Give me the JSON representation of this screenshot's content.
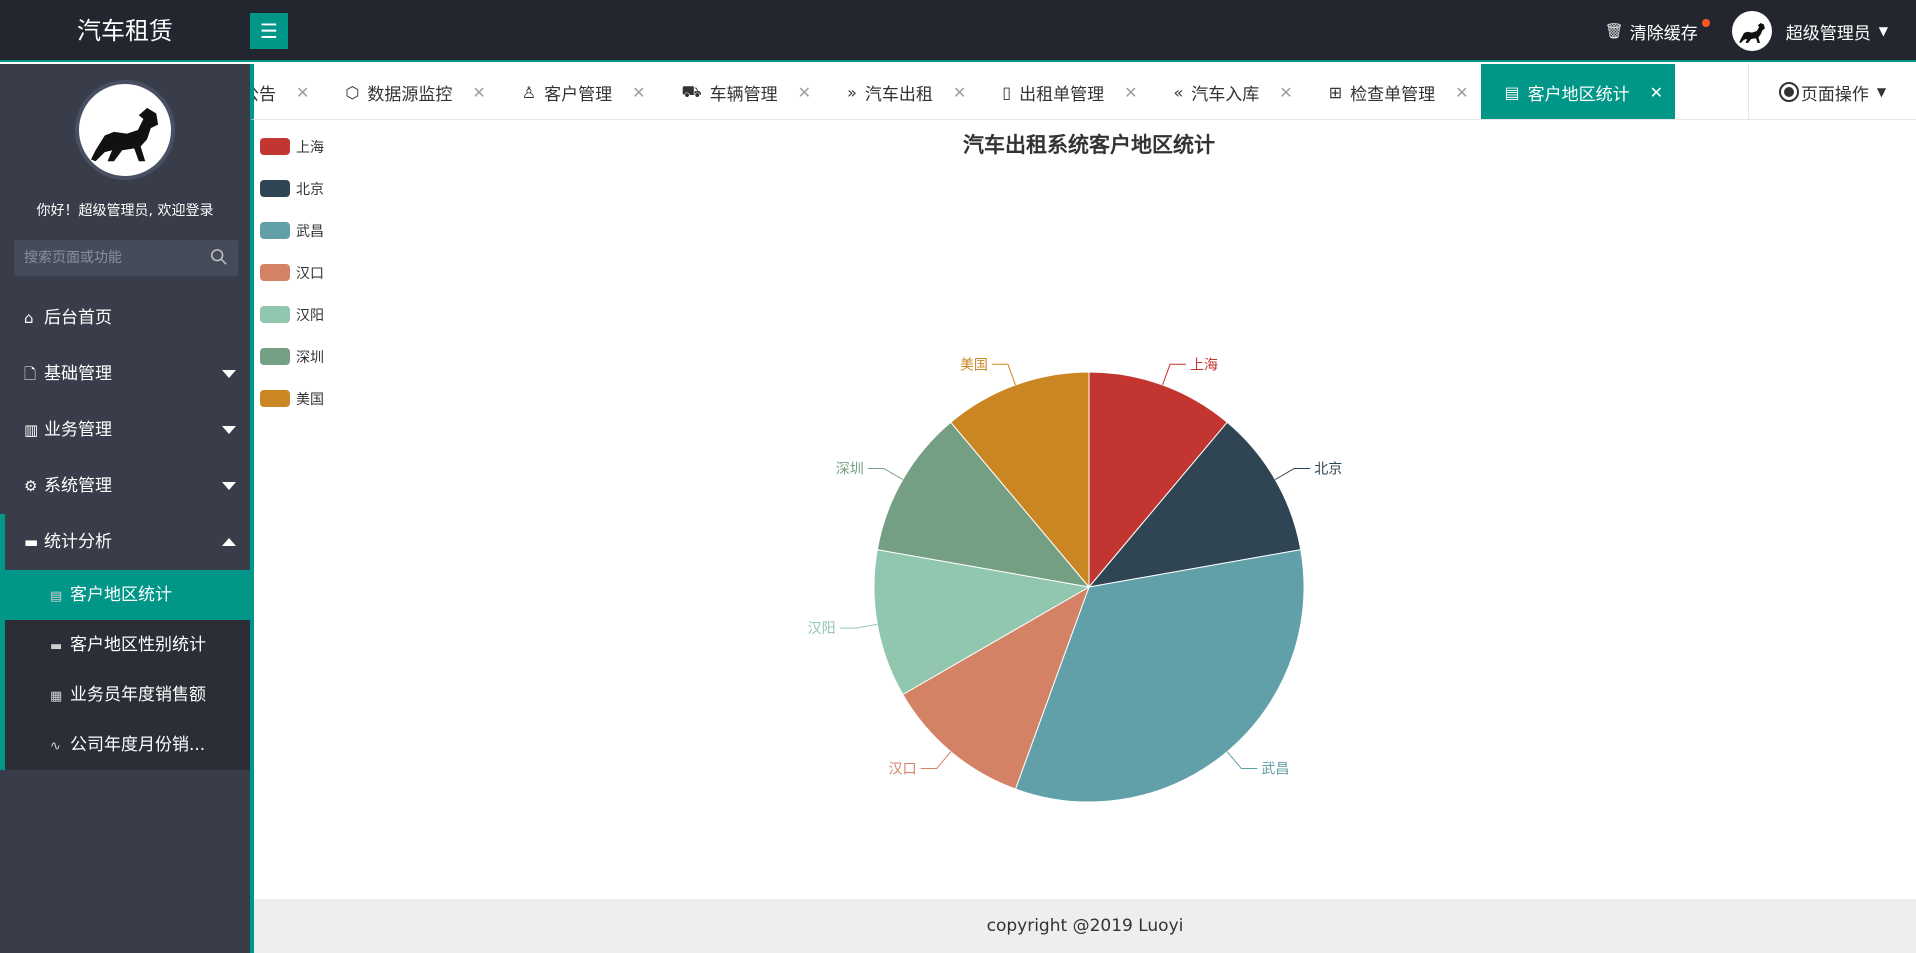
{
  "app": {
    "title": "汽车租赁"
  },
  "header": {
    "clear_cache": "清除缓存",
    "user_name": "超级管理员"
  },
  "sidebar": {
    "welcome": "你好！超级管理员, 欢迎登录",
    "search_placeholder": "搜索页面或功能",
    "items": [
      {
        "label": "后台首页",
        "icon": "home-icon"
      },
      {
        "label": "基础管理",
        "icon": "file-icon"
      },
      {
        "label": "业务管理",
        "icon": "book-icon"
      },
      {
        "label": "系统管理",
        "icon": "gear-icon"
      },
      {
        "label": "统计分析",
        "icon": "monitor-icon"
      }
    ],
    "sub_items": [
      {
        "label": "客户地区统计",
        "icon": "clipboard-icon"
      },
      {
        "label": "客户地区性别统计",
        "icon": "monitor-icon"
      },
      {
        "label": "业务员年度销售额",
        "icon": "table-icon"
      },
      {
        "label": "公司年度月份销...",
        "icon": "pulse-icon"
      }
    ]
  },
  "tabs": {
    "items": [
      {
        "label": "公告",
        "icon": ""
      },
      {
        "label": "数据源监控",
        "icon": "cube-icon"
      },
      {
        "label": "客户管理",
        "icon": "user-icon"
      },
      {
        "label": "车辆管理",
        "icon": "cart-icon"
      },
      {
        "label": "汽车出租",
        "icon": "double-right-icon"
      },
      {
        "label": "出租单管理",
        "icon": "doc-question-icon"
      },
      {
        "label": "汽车入库",
        "icon": "double-left-icon"
      },
      {
        "label": "检查单管理",
        "icon": "open-book-icon"
      },
      {
        "label": "客户地区统计",
        "icon": "clipboard-icon"
      }
    ],
    "page_ops": "页面操作"
  },
  "chart_data": {
    "type": "pie",
    "title": "汽车出租系统客户地区统计",
    "categories": [
      "上海",
      "北京",
      "武昌",
      "汉口",
      "汉阳",
      "深圳",
      "美国"
    ],
    "values": [
      1,
      1,
      3,
      1,
      1,
      1,
      1
    ],
    "colors": [
      "#c23531",
      "#2f4554",
      "#61a0a8",
      "#d48265",
      "#91c7ae",
      "#749f83",
      "#ca8622"
    ],
    "legend_position": "top-left"
  },
  "footer": {
    "copyright": "copyright @2019 Luoyi"
  }
}
